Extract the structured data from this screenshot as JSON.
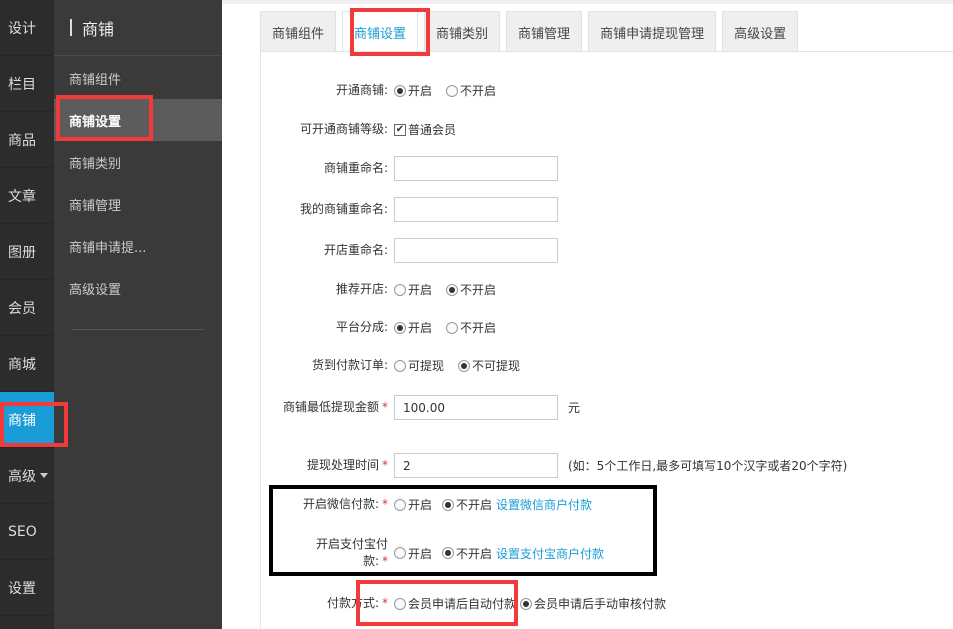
{
  "left_nav": {
    "items": [
      "设计",
      "栏目",
      "商品",
      "文章",
      "图册",
      "会员",
      "商城",
      "商铺",
      "高级",
      "SEO",
      "设置"
    ],
    "active": "商铺"
  },
  "sub_nav": {
    "title": "商铺",
    "items": [
      "商铺组件",
      "商铺设置",
      "商铺类别",
      "商铺管理",
      "商铺申请提...",
      "高级设置"
    ],
    "active": "商铺设置"
  },
  "tabs": [
    "商铺组件",
    "商铺设置",
    "商铺类别",
    "商铺管理",
    "商铺申请提现管理",
    "高级设置"
  ],
  "active_tab": "商铺设置",
  "form": {
    "open_shop": {
      "label": "开通商铺:",
      "options": [
        "开启",
        "不开启"
      ],
      "selected": "开启"
    },
    "shop_levels": {
      "label": "可开通商铺等级:",
      "option": "普通会员",
      "checked": true
    },
    "shop_rename": {
      "label": "商铺重命名:",
      "value": ""
    },
    "my_shop_rename": {
      "label": "我的商铺重命名:",
      "value": ""
    },
    "open_store_rename": {
      "label": "开店重命名:",
      "value": ""
    },
    "recommend_store": {
      "label": "推荐开店:",
      "options": [
        "开启",
        "不开启"
      ],
      "selected": "不开启"
    },
    "platform_share": {
      "label": "平台分成:",
      "options": [
        "开启",
        "不开启"
      ],
      "selected": "开启"
    },
    "cod_orders": {
      "label": "货到付款订单:",
      "options": [
        "可提现",
        "不可提现"
      ],
      "selected": "不可提现"
    },
    "min_withdraw": {
      "label": "商铺最低提现金额",
      "value": "100.00",
      "unit": "元"
    },
    "withdraw_time": {
      "label": "提现处理时间",
      "value": "2",
      "hint": "(如：5个工作日,最多可填写10个汉字或者20个字符)"
    },
    "wechat_pay": {
      "label": "开启微信付款:",
      "options": [
        "开启",
        "不开启"
      ],
      "selected": "不开启",
      "link": "设置微信商户付款"
    },
    "alipay": {
      "label": "开启支付宝付款:",
      "options": [
        "开启",
        "不开启"
      ],
      "selected": "不开启",
      "link": "设置支付宝商户付款"
    },
    "payment_method": {
      "label": "付款方式:",
      "options": [
        "会员申请后自动付款",
        "会员申请后手动审核付款"
      ],
      "selected": "会员申请后手动审核付款"
    },
    "required_mark": "*"
  },
  "colors": {
    "accent": "#1a9cd7",
    "highlight": "#f23a3a",
    "sidebar": "#2c2c2c",
    "subnav": "#3a3a3a"
  }
}
